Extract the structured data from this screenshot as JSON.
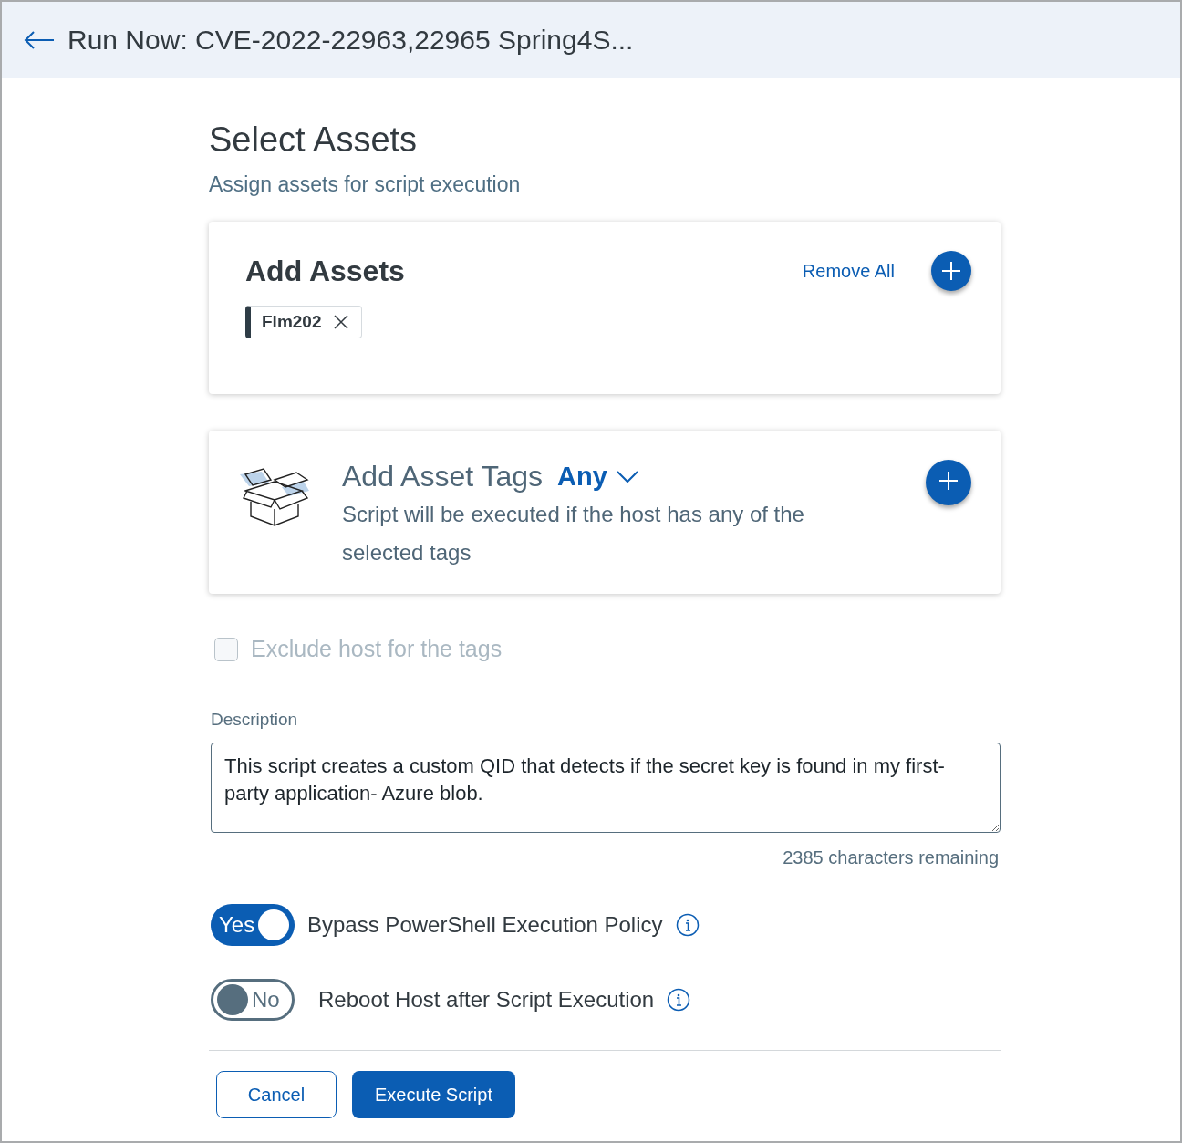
{
  "header": {
    "title": "Run Now: CVE-2022-22963,22965 Spring4S..."
  },
  "section": {
    "title": "Select Assets",
    "subtitle": "Assign assets for script execution"
  },
  "assets_card": {
    "title": "Add Assets",
    "remove_all": "Remove All",
    "assets": [
      {
        "label": "Flm202"
      }
    ]
  },
  "tags_card": {
    "title": "Add Asset Tags",
    "match": "Any",
    "description": "Script will be executed if the host has any of the selected tags"
  },
  "exclude": {
    "label": "Exclude host for the tags",
    "checked": false,
    "disabled": true
  },
  "description": {
    "label": "Description",
    "value": "This script creates a custom QID that detects if the secret key is found in my first-party application- Azure blob.",
    "remaining": "2385 characters remaining"
  },
  "toggles": [
    {
      "state_label": "Yes",
      "on": true,
      "label": "Bypass PowerShell Execution Policy"
    },
    {
      "state_label": "No",
      "on": false,
      "label": "Reboot Host after Script Execution"
    }
  ],
  "buttons": [
    {
      "label": "Cancel",
      "kind": "secondary"
    },
    {
      "label": "Execute Script",
      "kind": "primary"
    }
  ]
}
